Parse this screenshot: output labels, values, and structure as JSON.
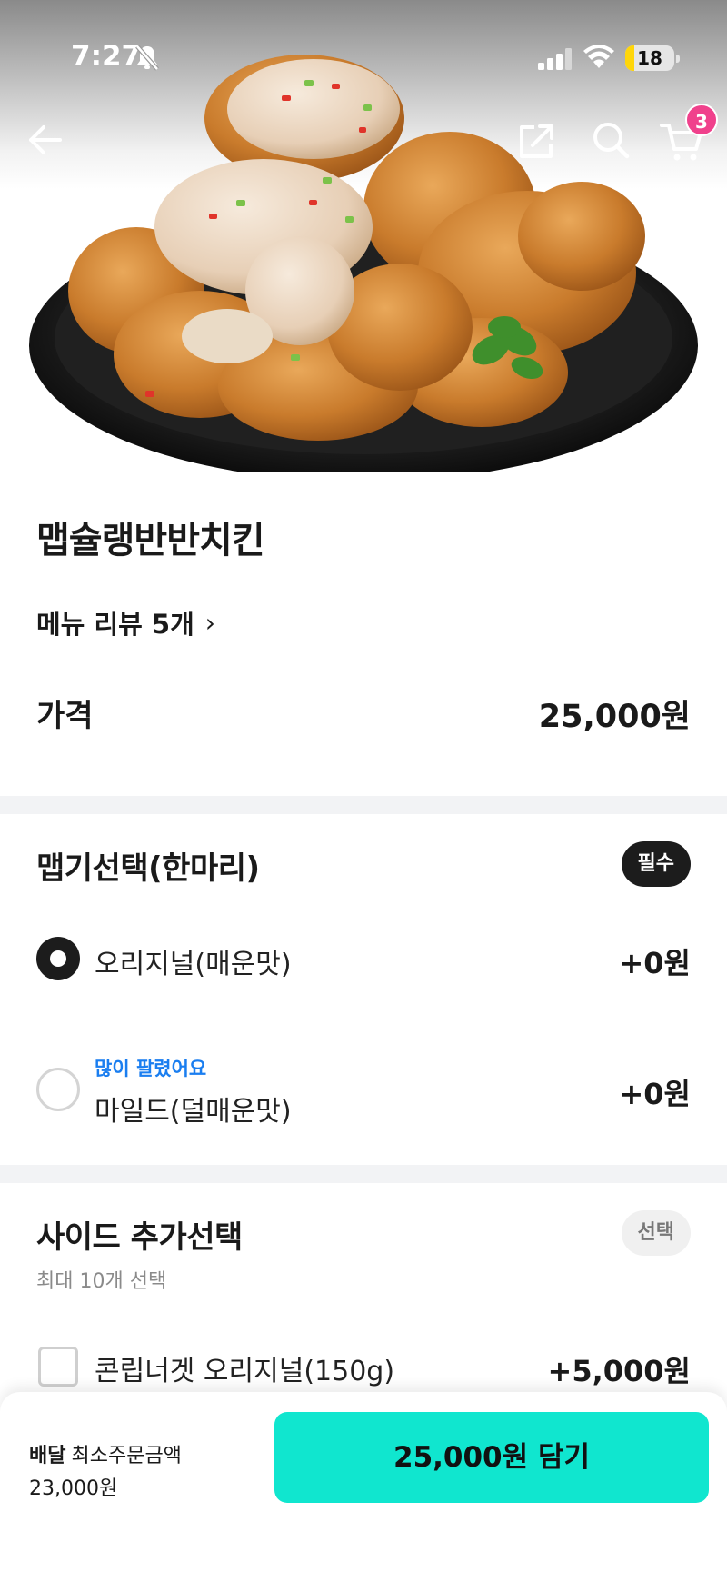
{
  "status_bar": {
    "time": "7:27",
    "battery": "18",
    "battery_level": 0.18,
    "icons": [
      "bell-muted-icon",
      "signal-icon",
      "wifi-icon",
      "battery-icon"
    ]
  },
  "nav": {
    "icons": [
      "back-arrow-icon",
      "share-icon",
      "search-icon",
      "cart-icon"
    ],
    "cart_count": "3",
    "badge_color": "#f0418c"
  },
  "product": {
    "name": "맵슐랭반반치킨",
    "review_link": "메뉴 리뷰 5개",
    "price_label": "가격",
    "price_value": "25,000원"
  },
  "spicy_group": {
    "title": "맵기선택(한마리)",
    "badge": "필수",
    "options": [
      {
        "label": "오리지널(매운맛)",
        "price": "+0원",
        "selected": true,
        "tag": ""
      },
      {
        "label": "마일드(덜매운맛)",
        "price": "+0원",
        "selected": false,
        "tag": "많이 팔렸어요"
      }
    ]
  },
  "side_group": {
    "title": "사이드 추가선택",
    "badge": "선택",
    "note": "최대 10개 선택",
    "options": [
      {
        "label": "콘립너겟 오리지널(150g)",
        "price": "+5,000원",
        "checked": false
      }
    ]
  },
  "bottom_bar": {
    "order_type": "배달",
    "min_label": "최소주문금액",
    "min_value": "23,000원",
    "cta": "25,000원 담기",
    "cta_color": "#10e6cf"
  }
}
